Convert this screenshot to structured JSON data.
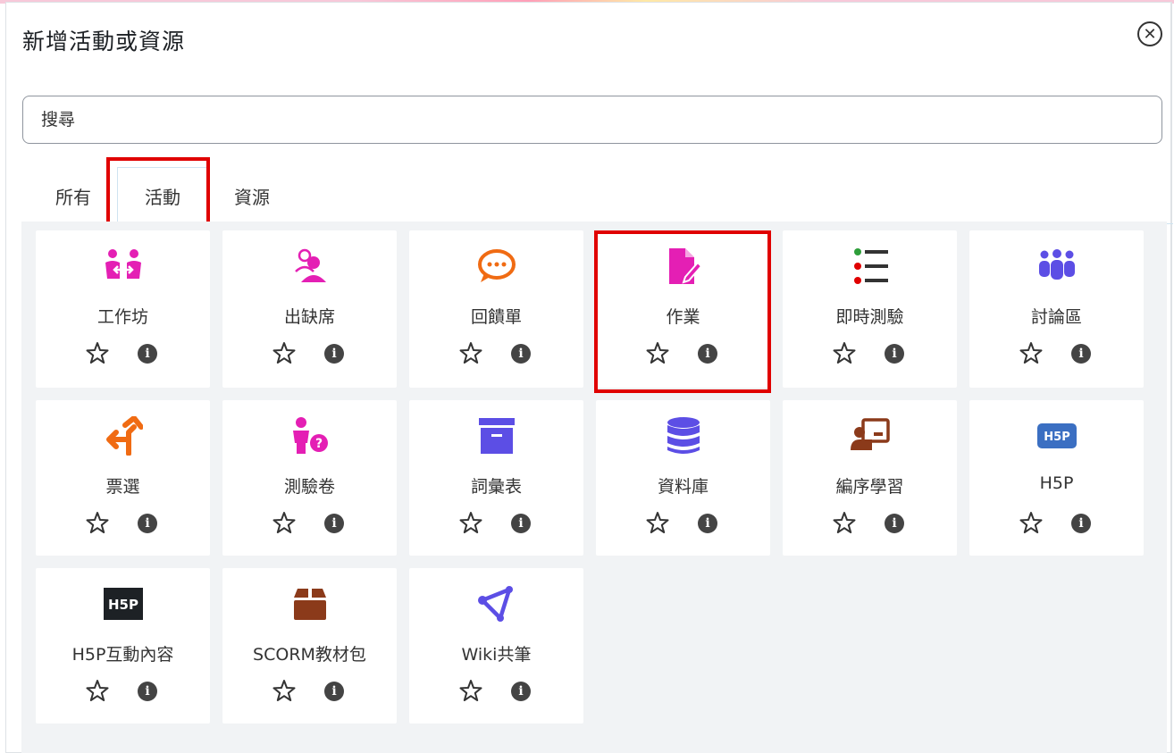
{
  "dialog": {
    "title": "新增活動或資源",
    "close_icon": "close-circle-icon"
  },
  "search": {
    "placeholder": "搜尋",
    "value": ""
  },
  "tabs": [
    {
      "label": "所有"
    },
    {
      "label": "活動",
      "selected": true
    },
    {
      "label": "資源"
    }
  ],
  "highlight_color": "#e00000",
  "modules": [
    {
      "name": "工作坊",
      "icon": "workshop-icon",
      "color": "#e41fb4"
    },
    {
      "name": "出缺席",
      "icon": "attendance-icon",
      "color": "#e41fb4"
    },
    {
      "name": "回饋單",
      "icon": "feedback-icon",
      "color": "#f06b13"
    },
    {
      "name": "作業",
      "icon": "assignment-icon",
      "color": "#e41fb4"
    },
    {
      "name": "即時測驗",
      "icon": "quiz-list-icon",
      "color": "#e00000"
    },
    {
      "name": "討論區",
      "icon": "forum-icon",
      "color": "#5c4ee5"
    },
    {
      "name": "票選",
      "icon": "choice-icon",
      "color": "#f06b13"
    },
    {
      "name": "測驗卷",
      "icon": "quiz-icon",
      "color": "#e41fb4"
    },
    {
      "name": "詞彙表",
      "icon": "glossary-icon",
      "color": "#5c4ee5"
    },
    {
      "name": "資料庫",
      "icon": "database-icon",
      "color": "#5c4ee5"
    },
    {
      "name": "編序學習",
      "icon": "lesson-icon",
      "color": "#8b3a1a"
    },
    {
      "name": "H5P",
      "icon": "h5p-icon",
      "color": "#3b6fc2"
    },
    {
      "name": "H5P互動內容",
      "icon": "h5p-interactive-icon",
      "color": "#1d2125"
    },
    {
      "name": "SCORM教材包",
      "icon": "scorm-package-icon",
      "color": "#8b3a1a"
    },
    {
      "name": "Wiki共筆",
      "icon": "wiki-icon",
      "color": "#5c4ee5"
    }
  ]
}
